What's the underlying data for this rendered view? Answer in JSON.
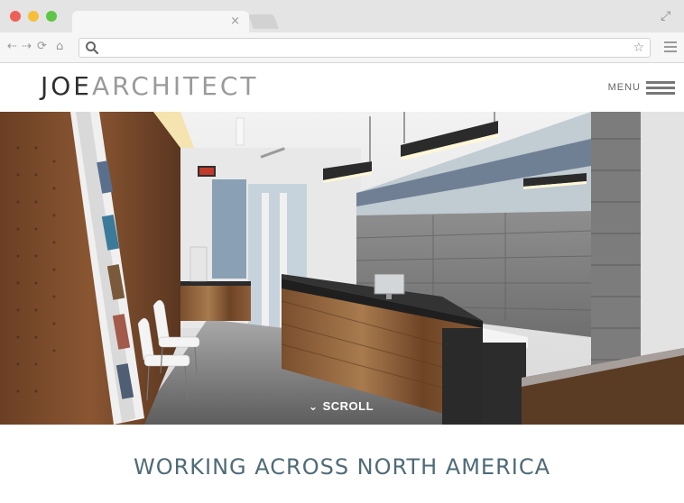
{
  "browser": {
    "tab_close": "×",
    "url": "",
    "icons": {
      "back": "back-arrow-icon",
      "forward": "forward-arrow-icon",
      "reload": "reload-icon",
      "home": "home-icon",
      "search": "search-icon",
      "star": "star-icon",
      "menu": "browser-menu-icon",
      "fullscreen": "fullscreen-icon"
    }
  },
  "site": {
    "logo_primary": "JOE",
    "logo_secondary": "ARCHITECT",
    "menu_label": "MENU"
  },
  "hero": {
    "scroll_label": "SCROLL"
  },
  "content": {
    "headline": "WORKING ACROSS NORTH AMERICA"
  },
  "colors": {
    "headline": "#4f6b76",
    "traffic_red": "#ee5f58",
    "traffic_yellow": "#f7be39",
    "traffic_green": "#5ec646"
  }
}
